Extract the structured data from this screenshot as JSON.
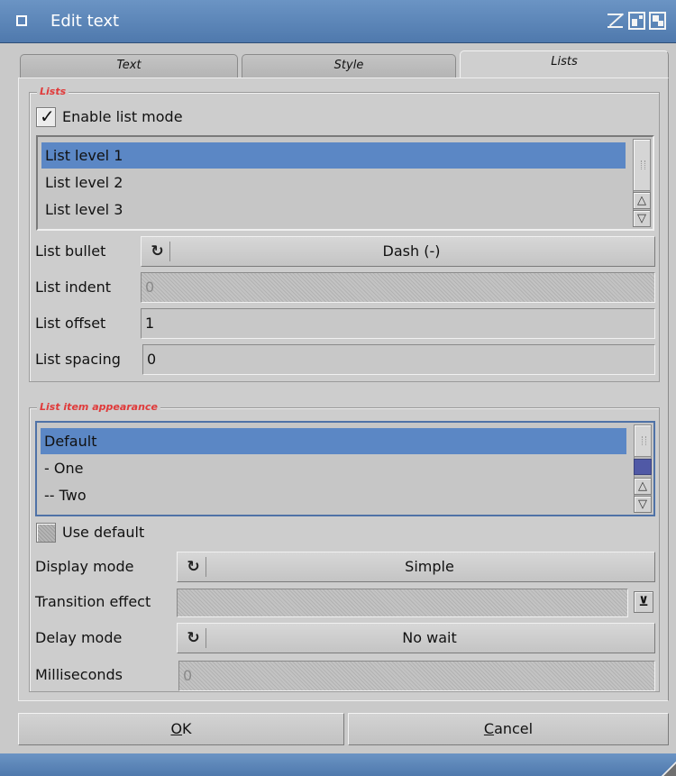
{
  "window": {
    "title": "Edit text"
  },
  "tabs": [
    {
      "label": "Text"
    },
    {
      "label": "Style"
    },
    {
      "label": "Lists"
    }
  ],
  "lists_group": {
    "title": "Lists",
    "enable_list_mode": {
      "label": "Enable list mode",
      "checked": true
    },
    "levels": [
      "List level 1",
      "List level 2",
      "List level 3"
    ],
    "selected_level": "List level 1",
    "list_bullet": {
      "label": "List bullet",
      "value": "Dash (-)"
    },
    "list_indent": {
      "label": "List indent",
      "value": "0"
    },
    "list_offset": {
      "label": "List offset",
      "value": "1"
    },
    "list_spacing": {
      "label": "List spacing",
      "value": "0"
    }
  },
  "appearance_group": {
    "title": "List item appearance",
    "items": [
      "Default",
      "- One",
      "-- Two"
    ],
    "selected_item": "Default",
    "use_default": {
      "label": "Use default",
      "checked": false
    },
    "display_mode": {
      "label": "Display mode",
      "value": "Simple"
    },
    "transition_effect": {
      "label": "Transition effect",
      "value": ""
    },
    "delay_mode": {
      "label": "Delay mode",
      "value": "No wait"
    },
    "milliseconds": {
      "label": "Milliseconds",
      "value": "0"
    }
  },
  "buttons": {
    "ok": {
      "underlined": "O",
      "rest": "K"
    },
    "cancel": {
      "underlined": "C",
      "rest": "ancel"
    }
  },
  "icons": {
    "close": "close-gadget-icon",
    "iconify": "iconify-icon",
    "zoom": "zoom-icon",
    "depth": "depth-icon",
    "cycle": "cycle-icon",
    "popup": "popup-icon"
  },
  "colors": {
    "titlebar": "#5b84b8",
    "selection": "#5b87c5",
    "group_title": "#e03a3a",
    "window_bg": "#c9c9c9"
  }
}
